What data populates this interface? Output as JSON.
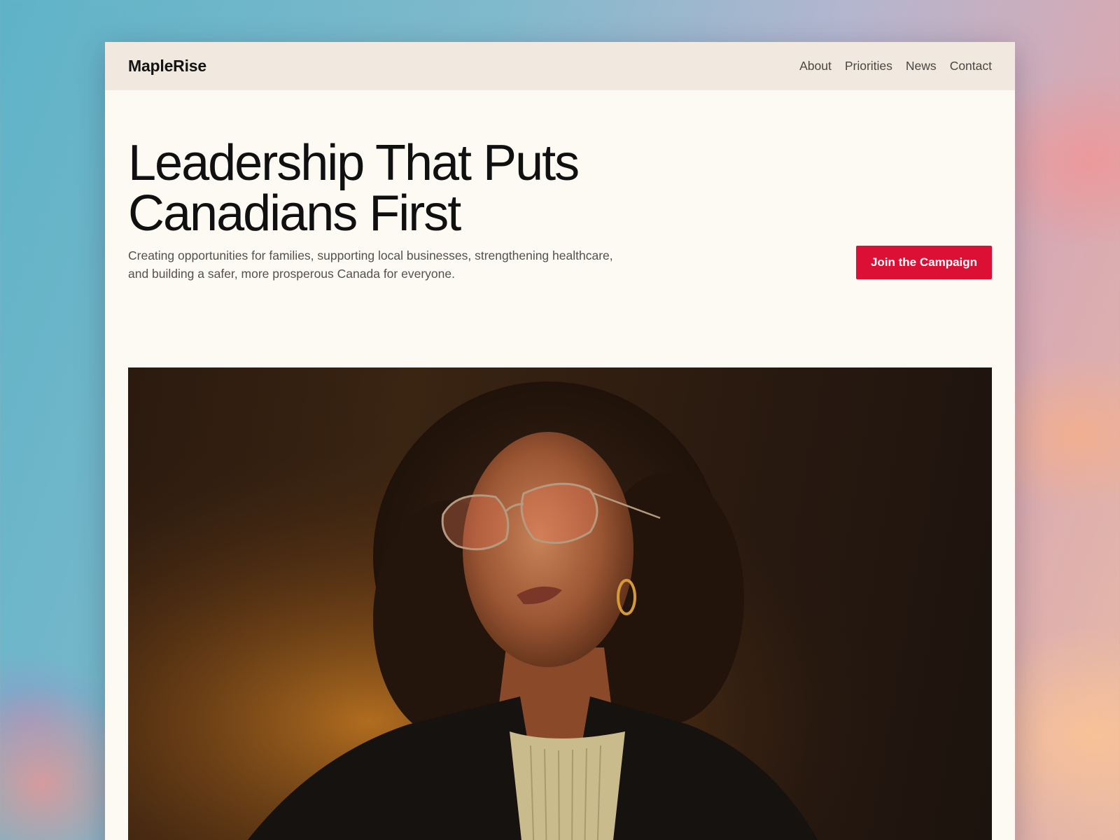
{
  "site": {
    "brand": "MapleRise",
    "nav": [
      {
        "label": "About"
      },
      {
        "label": "Priorities"
      },
      {
        "label": "News"
      },
      {
        "label": "Contact"
      }
    ]
  },
  "hero": {
    "title_line1": "Leadership That Puts",
    "title_line2": "Canadians First",
    "subtitle_line1": "Creating opportunities for families, supporting local businesses, strengthening healthcare,",
    "subtitle_line2": "and building a safer, more prosperous Canada for everyone.",
    "cta_label": "Join the Campaign"
  },
  "colors": {
    "accent": "#dc0f34",
    "nav_background": "#f1e9df",
    "page_background": "#fdf9f3"
  }
}
